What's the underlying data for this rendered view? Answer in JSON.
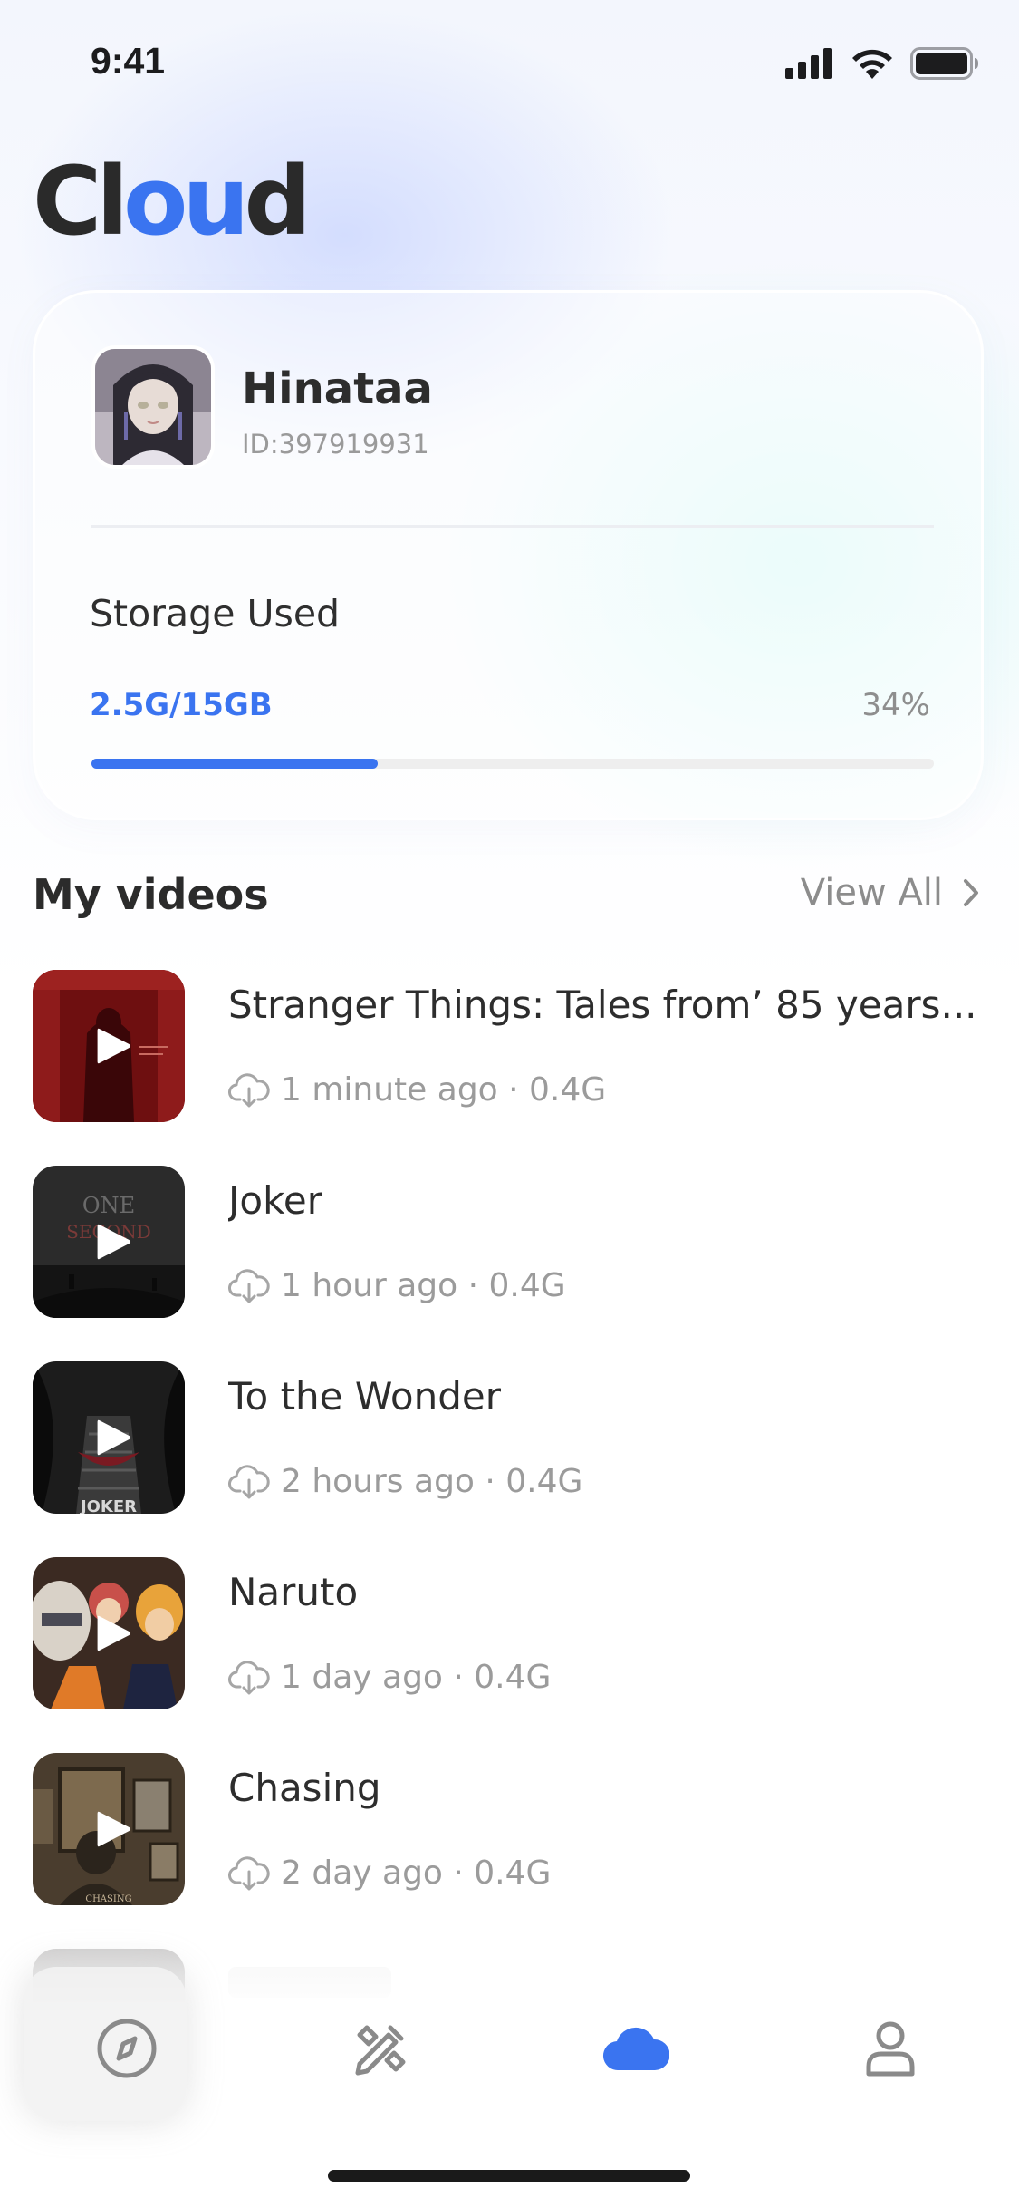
{
  "status_bar": {
    "time": "9:41"
  },
  "app": {
    "title_prefix": "Cl",
    "title_highlight": "ou",
    "title_suffix": "d",
    "accent_color": "#3a74f0"
  },
  "profile": {
    "name": "Hinataa",
    "id_text": "ID:397919931",
    "storage_label": "Storage Used",
    "storage_used": "2.5G/15GB",
    "storage_percent": "34%",
    "storage_fraction": 0.34
  },
  "videos_section": {
    "title": "My videos",
    "view_all": "View All"
  },
  "videos": [
    {
      "title": "Stranger Things: Tales from’ 85 years...",
      "meta": "1 minute ago · 0.4G"
    },
    {
      "title": "Joker",
      "meta": "1 hour ago · 0.4G"
    },
    {
      "title": "To the Wonder",
      "meta": "2 hours ago · 0.4G"
    },
    {
      "title": "Naruto",
      "meta": "1 day ago · 0.4G"
    },
    {
      "title": "Chasing",
      "meta": "2 day ago · 0.4G"
    }
  ],
  "tabs": [
    {
      "icon": "compass-icon",
      "active": false
    },
    {
      "icon": "tools-icon",
      "active": false
    },
    {
      "icon": "cloud-icon",
      "active": true
    },
    {
      "icon": "user-icon",
      "active": false
    }
  ]
}
